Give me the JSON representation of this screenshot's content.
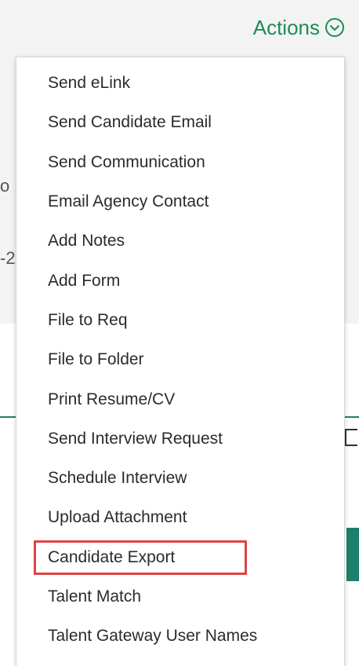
{
  "header": {
    "actions_label": "Actions",
    "actions_icon": "chevron-down-circle-icon",
    "accent_color": "#1d8b57"
  },
  "background": {
    "fragment_1": "o",
    "fragment_2": "-2"
  },
  "menu": {
    "items": [
      {
        "label": "Send eLink"
      },
      {
        "label": "Send Candidate Email"
      },
      {
        "label": "Send Communication"
      },
      {
        "label": "Email Agency Contact"
      },
      {
        "label": "Add Notes"
      },
      {
        "label": "Add Form"
      },
      {
        "label": "File to Req"
      },
      {
        "label": "File to Folder"
      },
      {
        "label": "Print Resume/CV"
      },
      {
        "label": "Send Interview Request"
      },
      {
        "label": "Schedule Interview"
      },
      {
        "label": "Upload Attachment"
      },
      {
        "label": "Candidate Export",
        "highlighted": true
      },
      {
        "label": "Talent Match"
      },
      {
        "label": "Talent Gateway User Names"
      }
    ],
    "highlight_color": "#e04444"
  }
}
